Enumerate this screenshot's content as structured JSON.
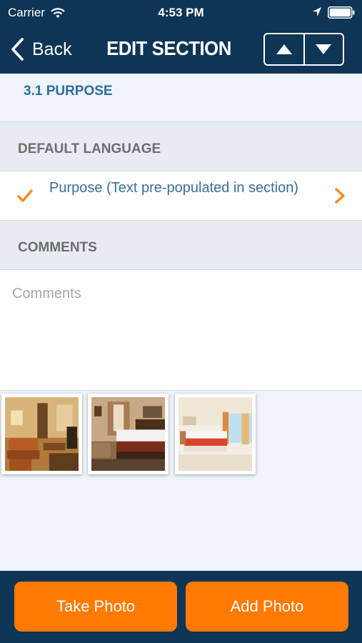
{
  "status_bar": {
    "carrier": "Carrier",
    "time": "4:53 PM",
    "icons": [
      "wifi-icon",
      "location-arrow-icon",
      "battery-icon"
    ]
  },
  "nav": {
    "back_label": "Back",
    "title": "EDIT SECTION",
    "up_icon": "triangle-up-icon",
    "down_icon": "triangle-down-icon"
  },
  "section": {
    "title": "3.1 PURPOSE"
  },
  "default_language": {
    "header": "DEFAULT LANGUAGE",
    "item_text": "Purpose (Text pre-populated in section)",
    "checked": true
  },
  "comments": {
    "header": "COMMENTS",
    "placeholder": "Comments",
    "value": ""
  },
  "photos": [
    {
      "subject": "hotel lounge"
    },
    {
      "subject": "hotel bedroom"
    },
    {
      "subject": "bright hotel room"
    }
  ],
  "actions": {
    "take_photo": "Take Photo",
    "add_photo": "Add Photo"
  },
  "colors": {
    "nav_background": "#0e3555",
    "accent_orange": "#ff7a00",
    "section_title": "#2f6ba2",
    "page_background": "#eef4fa"
  }
}
